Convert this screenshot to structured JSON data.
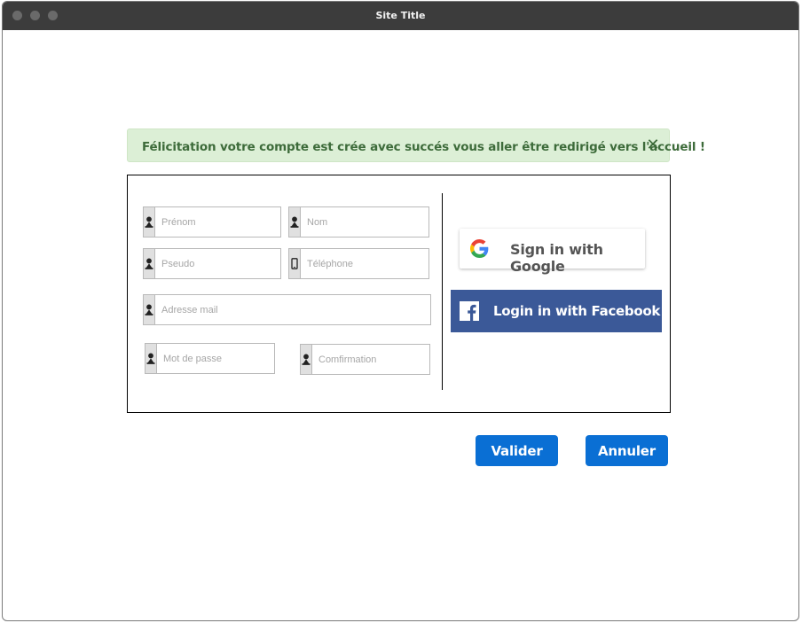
{
  "window": {
    "title": "Site Title"
  },
  "alert": {
    "message": "Félicitation votre compte est crée avec succés vous aller être redirigé vers l'accueil !",
    "close_glyph": "✕",
    "color": "#3d6b3a",
    "background": "#dcefd6"
  },
  "form": {
    "prenom": {
      "placeholder": "Prénom",
      "icon": "user-icon"
    },
    "nom": {
      "placeholder": "Nom",
      "icon": "user-icon"
    },
    "pseudo": {
      "placeholder": "Pseudo",
      "icon": "user-icon"
    },
    "telephone": {
      "placeholder": "Téléphone",
      "icon": "phone-icon"
    },
    "email": {
      "placeholder": "Adresse mail",
      "icon": "user-icon"
    },
    "password": {
      "placeholder": "Mot de passe",
      "icon": "user-icon"
    },
    "confirmation": {
      "placeholder": "Comfirmation",
      "icon": "user-icon"
    }
  },
  "social": {
    "google_label": "Sign in with Google",
    "facebook_label": "Login in with Facebook",
    "facebook_color": "#3b5998"
  },
  "actions": {
    "submit_label": "Valider",
    "cancel_label": "Annuler",
    "accent": "#0a6fd4"
  }
}
